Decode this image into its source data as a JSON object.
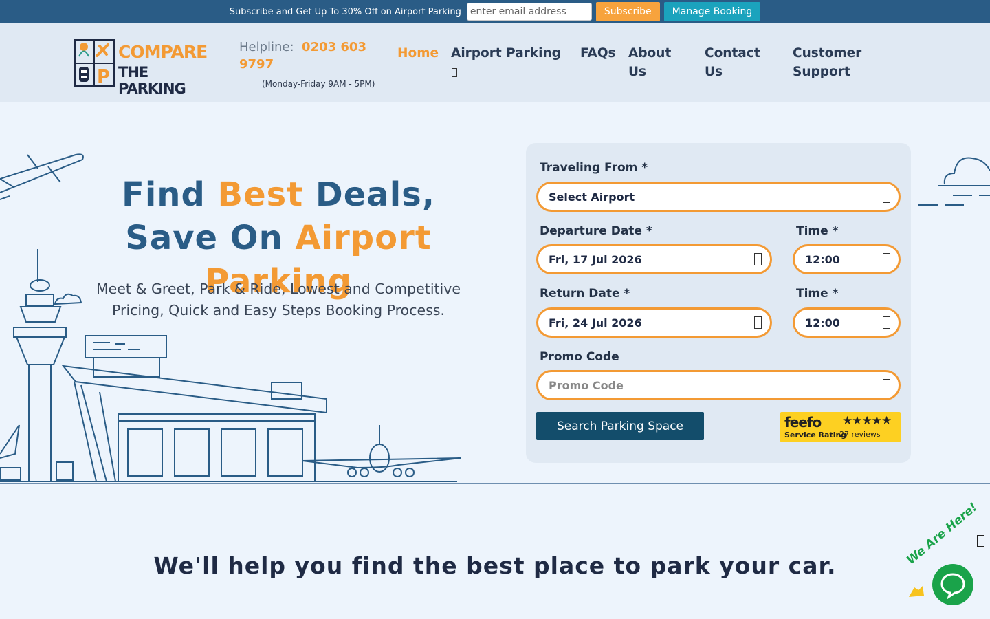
{
  "topbar": {
    "promo_text": "Subscribe and Get Up To 30% Off on Airport Parking",
    "email_placeholder": "enter email address",
    "subscribe_label": "Subscribe",
    "manage_label": "Manage Booking"
  },
  "header": {
    "logo_line1": "COMPARE",
    "logo_line2": "THE PARKING",
    "helpline_label": "Helpline:",
    "helpline_number": "0203 603 9797",
    "helpline_hours": "(Monday-Friday 9AM - 5PM)",
    "nav": {
      "home": "Home",
      "airport_parking": "Airport Parking",
      "faqs": "FAQs",
      "about": "About Us",
      "contact": "Contact Us",
      "support": "Customer Support"
    }
  },
  "hero": {
    "title_part1": "Find ",
    "title_hl1": "Best",
    "title_part2": " Deals, Save On ",
    "title_hl2": "Airport Parking",
    "subtitle": "Meet & Greet, Park & Ride, Lowest and Competitive Pricing, Quick and Easy Steps Booking Process."
  },
  "form": {
    "traveling_from_label": "Traveling From *",
    "traveling_from_value": "Select Airport",
    "departure_label": "Departure Date *",
    "departure_value": "Fri, 17 Jul 2026",
    "departure_time_label": "Time *",
    "departure_time_value": "12:00",
    "return_label": "Return Date *",
    "return_value": "Fri, 24 Jul 2026",
    "return_time_label": "Time *",
    "return_time_value": "12:00",
    "promo_label": "Promo Code",
    "promo_placeholder": "Promo Code",
    "search_label": "Search Parking Space"
  },
  "feefo": {
    "brand": "feefo",
    "stars": "★★★★★",
    "rating_label": "Service Rating",
    "reviews": "27 reviews"
  },
  "section": {
    "title": "We'll help you find the best place to park your car."
  },
  "chat": {
    "label": "We Are Here!"
  },
  "colors": {
    "topbar": "#2a5c86",
    "accent": "#f39a34",
    "teal": "#1ba3bd",
    "search_button": "#134d6b",
    "chat_green": "#1aa34a"
  }
}
